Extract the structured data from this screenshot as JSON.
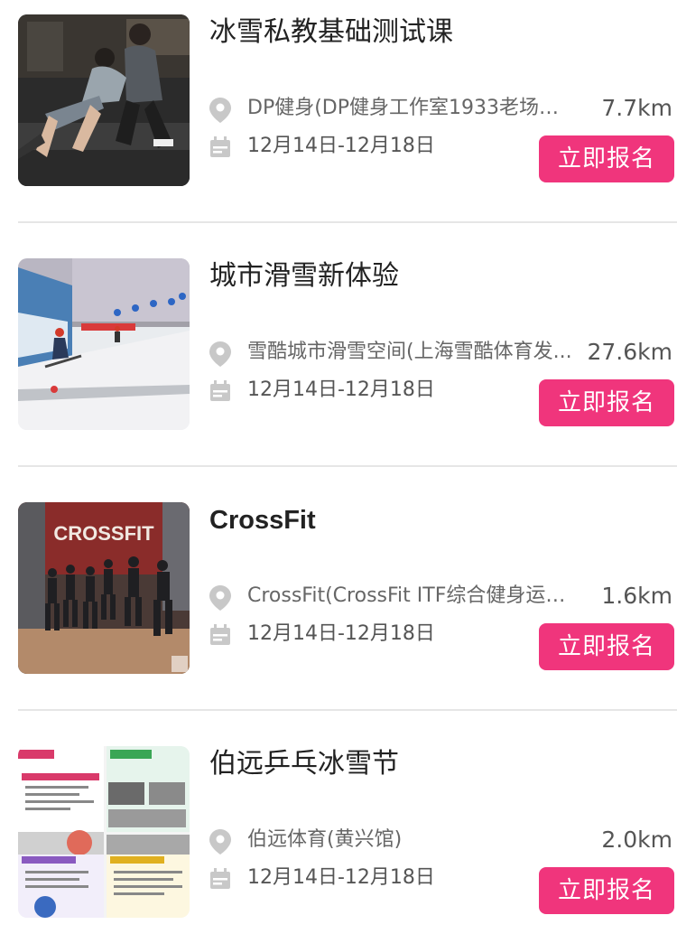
{
  "colors": {
    "accent": "#f0357c",
    "title": "#222222",
    "meta": "#666666",
    "icon": "#c8c8c8",
    "divider": "#e6e6e6"
  },
  "icons": {
    "location": "map-pin-icon",
    "date": "calendar-icon"
  },
  "items": [
    {
      "title": "冰雪私教基础测试课",
      "location": "DP健身(DP健身工作室1933老场坊...",
      "distance": "7.7km",
      "date": "12月14日-12月18日",
      "button": "立即报名"
    },
    {
      "title": "城市滑雪新体验",
      "location": "雪酷城市滑雪空间(上海雪酷体育发...",
      "distance": "27.6km",
      "date": "12月14日-12月18日",
      "button": "立即报名"
    },
    {
      "title": "CrossFit",
      "location": "CrossFit(CrossFit ITF综合健身运动..",
      "distance": "1.6km",
      "date": "12月14日-12月18日",
      "button": "立即报名",
      "thumb_sign": "CROSSFIT"
    },
    {
      "title": "伯远乒乓冰雪节",
      "location": "伯远体育(黄兴馆)",
      "distance": "2.0km",
      "date": "12月14日-12月18日",
      "button": "立即报名"
    }
  ]
}
